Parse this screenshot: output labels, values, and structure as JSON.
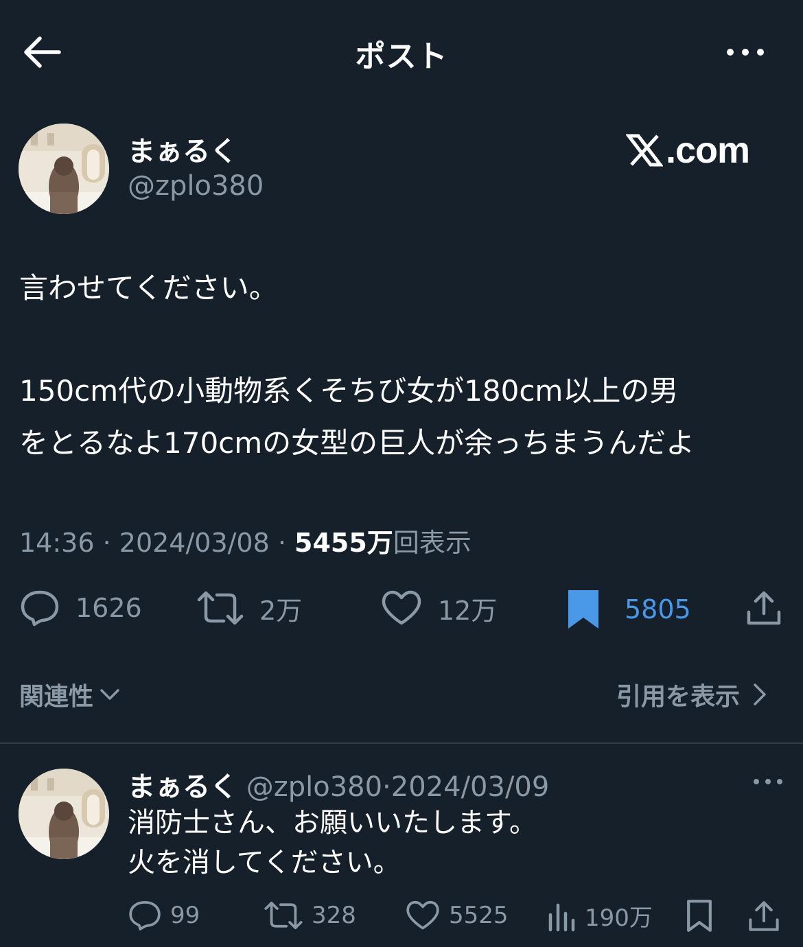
{
  "header": {
    "title": "ポスト",
    "back_icon": "arrow-left-icon",
    "more_icon": "more-horizontal-icon"
  },
  "post": {
    "author_name": "まぁるく",
    "author_handle": "@zplo380",
    "watermark": ".com",
    "body_lines": [
      "言わせてください。",
      "150cm代の小動物系くそちび女が180cm以上の男",
      "をとるなよ170cmの女型の巨人が余っちまうんだよ"
    ],
    "time": "14:36",
    "date": "2024/03/08",
    "views_count": "5455万",
    "views_label": "回表示",
    "separator": " · ",
    "stats": {
      "replies": "1626",
      "retweets": "2万",
      "likes": "12万",
      "bookmarks": "5805"
    }
  },
  "relevance_label": "関連性",
  "quotes_label": "引用を表示",
  "reply": {
    "author_name": "まぁるく",
    "author_handle": "@zplo380",
    "date": "2024/03/09",
    "separator": "·",
    "lines": [
      "消防士さん、お願いいたします。",
      "火を消してください。"
    ],
    "stats": {
      "replies": "99",
      "retweets": "328",
      "likes": "5525",
      "views": "190万"
    }
  },
  "colors": {
    "background": "#15202b",
    "muted": "#8b98a5",
    "accent": "#4a99e9"
  }
}
